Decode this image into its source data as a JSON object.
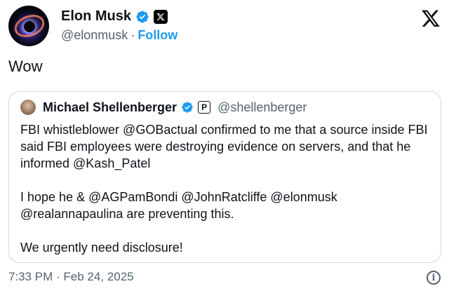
{
  "author": {
    "name": "Elon Musk",
    "handle": "@elonmusk",
    "separator": "·",
    "follow_label": "Follow",
    "verified_icon": "verified-badge-icon",
    "affiliation_icon": "x-affiliation-icon",
    "avatar_icon": "avatar"
  },
  "brand": {
    "logo_icon": "x-logo-icon"
  },
  "tweet": {
    "text": "Wow"
  },
  "quote": {
    "author_name": "Michael Shellenberger",
    "author_handle": "@shellenberger",
    "affiliation_letter": "P",
    "paragraphs": [
      "FBI whistleblower @GOBactual confirmed to me that a source inside FBI said FBI employees were destroying evidence on servers, and that he informed  @Kash_Patel",
      "I hope he & @AGPamBondi @JohnRatcliffe @elonmusk @realannapaulina are preventing this.",
      "We urgently need disclosure!"
    ]
  },
  "footer": {
    "timestamp": "7:33 PM · Feb 24, 2025",
    "info_icon": "info-icon"
  },
  "colors": {
    "accent": "#1d9bf0",
    "text": "#0f1419",
    "muted": "#536471",
    "border": "#cfd9de"
  }
}
